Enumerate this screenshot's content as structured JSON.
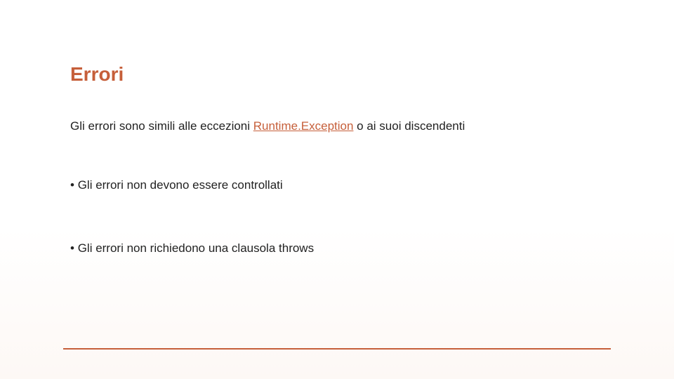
{
  "title": "Errori",
  "intro": {
    "before": "Gli errori sono simili alle eccezioni ",
    "link": "Runtime.Exception",
    "after": " o ai suoi discendenti"
  },
  "bullets": [
    "Gli errori non devono essere controllati",
    "Gli errori non richiedono una clausola throws"
  ],
  "colors": {
    "accent": "#c65f3a",
    "text": "#222222"
  }
}
